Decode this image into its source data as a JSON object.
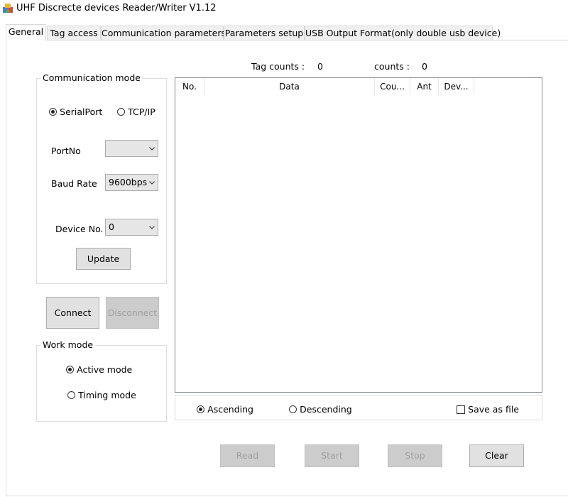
{
  "window": {
    "title": "UHF Discrecte devices Reader/Writer V1.12"
  },
  "tabs": [
    {
      "label": "General",
      "active": true
    },
    {
      "label": "Tag access",
      "active": false
    },
    {
      "label": "Communication parameters",
      "active": false
    },
    {
      "label": "Parameters setup",
      "active": false
    },
    {
      "label": "USB Output Format(only double usb device)",
      "active": false
    }
  ],
  "stats": {
    "tag_counts_label": "Tag counts :",
    "tag_counts_value": "0",
    "counts_label": "counts :",
    "counts_value": "0"
  },
  "communication": {
    "title": "Communication mode",
    "serial_label": "SerialPort",
    "tcp_label": "TCP/IP",
    "selected": "SerialPort",
    "port_label": "PortNo",
    "port_value": "",
    "baud_label": "Baud Rate",
    "baud_value": "9600bps",
    "device_label": "Device No.",
    "device_value": "0",
    "update_label": "Update"
  },
  "connection": {
    "connect_label": "Connect",
    "disconnect_label": "Disconnect"
  },
  "work_mode": {
    "title": "Work mode",
    "active_label": "Active mode",
    "timing_label": "Timing mode",
    "selected": "Active mode"
  },
  "table": {
    "columns": [
      "No.",
      "Data",
      "Cou...",
      "Ant",
      "Dev..."
    ],
    "rows": []
  },
  "sort": {
    "ascending_label": "Ascending",
    "descending_label": "Descending",
    "selected": "Ascending",
    "save_label": "Save as file",
    "save_checked": false
  },
  "actions": {
    "read_label": "Read",
    "start_label": "Start",
    "stop_label": "Stop",
    "clear_label": "Clear"
  }
}
